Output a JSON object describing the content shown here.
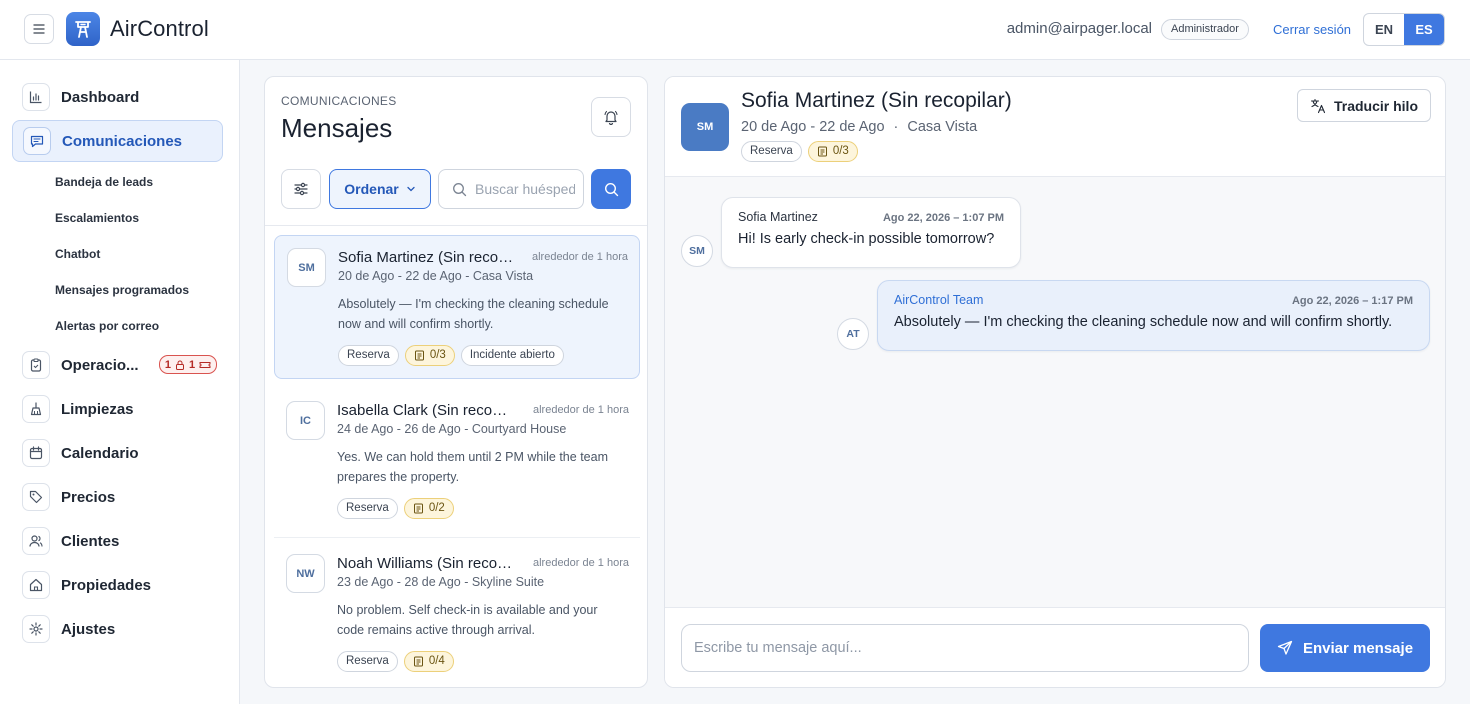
{
  "header": {
    "app_title": "AirControl",
    "user_email": "admin@airpager.local",
    "role": "Administrador",
    "logout": "Cerrar sesión",
    "languages": [
      {
        "code": "EN",
        "active": false
      },
      {
        "code": "ES",
        "active": true
      }
    ],
    "icons": {
      "menu": "hamburger-icon",
      "logo": "control-tower-icon"
    }
  },
  "sidebar": {
    "items": [
      {
        "label": "Dashboard",
        "icon": "bar-chart-icon"
      },
      {
        "label": "Comunicaciones",
        "icon": "message-square-icon",
        "active": true
      },
      {
        "label": "Operacio...",
        "icon": "clipboard-icon"
      },
      {
        "label": "Limpiezas",
        "icon": "broom-icon"
      },
      {
        "label": "Calendario",
        "icon": "calendar-icon"
      },
      {
        "label": "Precios",
        "icon": "tag-icon"
      },
      {
        "label": "Clientes",
        "icon": "users-icon"
      },
      {
        "label": "Propiedades",
        "icon": "home-icon"
      },
      {
        "label": "Ajustes",
        "icon": "gear-icon"
      }
    ],
    "sub_items": [
      "Bandeja de leads",
      "Escalamientos",
      "Chatbot",
      "Mensajes programados",
      "Alertas por correo"
    ],
    "ops_badge": {
      "count_a": "1",
      "count_b": "1",
      "icon_a": "lock-icon",
      "icon_b": "ticket-icon"
    }
  },
  "messages_panel": {
    "eyebrow": "COMUNICACIONES",
    "title": "Mensajes",
    "sort_label": "Ordenar",
    "search_placeholder": "Buscar huésped",
    "icons": {
      "bell": "bell-icon",
      "filter": "sliders-icon",
      "search": "search-icon"
    },
    "conversations": [
      {
        "initials": "SM",
        "name": "Sofia Martinez (Sin recopilar)",
        "time": "alrededor de 1 hora",
        "dates": "20 de Ago - 22 de Ago - Casa Vista",
        "snippet": "Absolutely — I'm checking the cleaning schedule now and will confirm shortly.",
        "tags": {
          "reservation": "Reserva",
          "checklist": "0/3",
          "incident": "Incidente abierto"
        },
        "active": true
      },
      {
        "initials": "IC",
        "name": "Isabella Clark (Sin recopilar)",
        "time": "alrededor de 1 hora",
        "dates": "24 de Ago - 26 de Ago - Courtyard House",
        "snippet": "Yes. We can hold them until 2 PM while the team prepares the property.",
        "tags": {
          "reservation": "Reserva",
          "checklist": "0/2"
        }
      },
      {
        "initials": "NW",
        "name": "Noah Williams (Sin recopilar)",
        "time": "alrededor de 1 hora",
        "dates": "23 de Ago - 28 de Ago - Skyline Suite",
        "snippet": "No problem. Self check-in is available and your code remains active through arrival.",
        "tags": {
          "reservation": "Reserva",
          "checklist": "0/4"
        }
      }
    ]
  },
  "chat": {
    "initials": "SM",
    "name": "Sofia Martinez (Sin recopilar)",
    "dates": "20 de Ago - 22 de Ago",
    "separator": "·",
    "property": "Casa Vista",
    "tags": {
      "reservation": "Reserva",
      "checklist": "0/3"
    },
    "translate_label": "Traducir hilo",
    "messages": [
      {
        "initials": "SM",
        "sender": "Sofia Martinez",
        "timestamp": "Ago 22, 2026 – 1:07 PM",
        "text": "Hi! Is early check-in possible tomorrow?",
        "direction": "in"
      },
      {
        "initials": "AT",
        "sender": "AirControl Team",
        "timestamp": "Ago 22, 2026 – 1:17 PM",
        "text": "Absolutely — I'm checking the cleaning schedule now and will confirm shortly.",
        "direction": "out"
      }
    ],
    "composer_placeholder": "Escribe tu mensaje aquí...",
    "send_label": "Enviar mensaje",
    "icons": {
      "translate": "translate-icon",
      "send": "send-icon",
      "checklist": "checklist-icon"
    },
    "colors": {
      "accent": "#3f78e0",
      "active_bg": "#eaf1fd",
      "checklist_bg": "#fdf5dc"
    }
  }
}
